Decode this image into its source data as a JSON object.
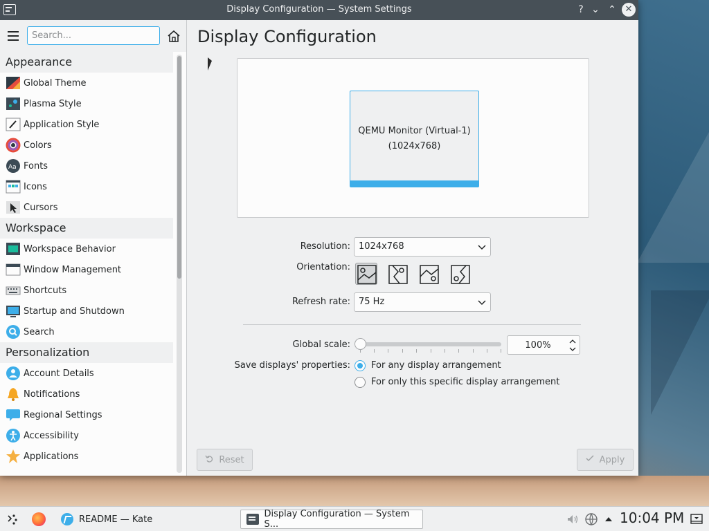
{
  "window": {
    "title": "Display Configuration — System Settings",
    "help": "?",
    "minimize": "⌄",
    "maximize": "⌃",
    "close": "✕"
  },
  "sidebar": {
    "search_placeholder": "Search...",
    "groups": [
      {
        "label": "Appearance",
        "items": [
          {
            "label": "Global Theme",
            "icon": "global-theme-icon"
          },
          {
            "label": "Plasma Style",
            "icon": "plasma-style-icon"
          },
          {
            "label": "Application Style",
            "icon": "application-style-icon"
          },
          {
            "label": "Colors",
            "icon": "colors-icon"
          },
          {
            "label": "Fonts",
            "icon": "fonts-icon"
          },
          {
            "label": "Icons",
            "icon": "icons-icon"
          },
          {
            "label": "Cursors",
            "icon": "cursors-icon"
          }
        ]
      },
      {
        "label": "Workspace",
        "items": [
          {
            "label": "Workspace Behavior",
            "icon": "workspace-behavior-icon"
          },
          {
            "label": "Window Management",
            "icon": "window-management-icon"
          },
          {
            "label": "Shortcuts",
            "icon": "keyboard-icon"
          },
          {
            "label": "Startup and Shutdown",
            "icon": "startup-icon"
          },
          {
            "label": "Search",
            "icon": "search-icon"
          }
        ]
      },
      {
        "label": "Personalization",
        "items": [
          {
            "label": "Account Details",
            "icon": "user-icon"
          },
          {
            "label": "Notifications",
            "icon": "bell-icon"
          },
          {
            "label": "Regional Settings",
            "icon": "regional-icon"
          },
          {
            "label": "Accessibility",
            "icon": "accessibility-icon"
          },
          {
            "label": "Applications",
            "icon": "star-icon"
          }
        ]
      }
    ]
  },
  "main": {
    "title": "Display Configuration",
    "monitor": {
      "name": "QEMU Monitor (Virtual-1)",
      "resolution": "(1024x768)"
    },
    "resolution_label": "Resolution:",
    "resolution_value": "1024x768",
    "orientation_label": "Orientation:",
    "refresh_label": "Refresh rate:",
    "refresh_value": "75 Hz",
    "scale_label": "Global scale:",
    "scale_value": "100%",
    "save_label": "Save displays' properties:",
    "radio_any": "For any display arrangement",
    "radio_specific": "For only this specific display arrangement",
    "reset_label": "Reset",
    "apply_label": "Apply"
  },
  "taskbar": {
    "kate_label": "README  — Kate",
    "settings_label": "Display Configuration  — System S...",
    "clock": "10:04 PM"
  },
  "colors": {
    "accent": "#3daee9",
    "titlebar": "#475057",
    "window_bg": "#eff0f1"
  }
}
